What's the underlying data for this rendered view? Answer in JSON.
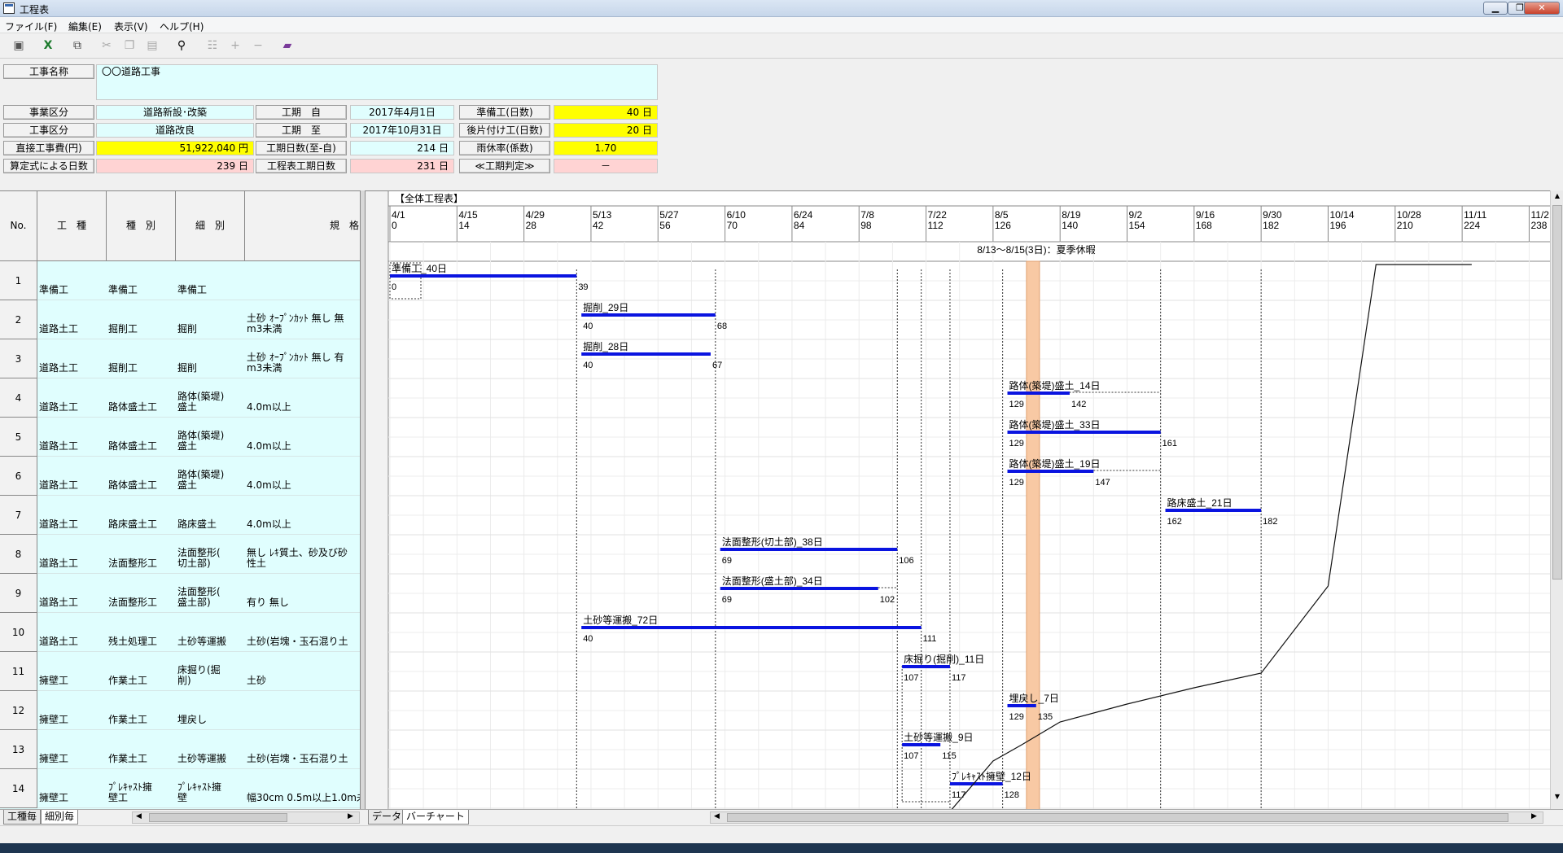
{
  "window": {
    "title": "工程表"
  },
  "menu": [
    "ファイル(F)",
    "編集(E)",
    "表示(V)",
    "ヘルプ(H)"
  ],
  "form": {
    "koji_name": {
      "label": "工事名称",
      "value": "〇〇道路工事"
    },
    "jigyo": {
      "label": "事業区分",
      "value": "道路新設･改築"
    },
    "koji_kubun": {
      "label": "工事区分",
      "value": "道路改良"
    },
    "chokusetsu": {
      "label": "直接工事費(円)",
      "value": "51,922,040 円"
    },
    "santei": {
      "label": "算定式による日数",
      "value": "239 日"
    },
    "kouki_from": {
      "label": "工期　自",
      "value": "2017年4月1日"
    },
    "kouki_to": {
      "label": "工期　至",
      "value": "2017年10月31日"
    },
    "kouki_days": {
      "label": "工期日数(至-自)",
      "value": "214 日"
    },
    "koteihyo_days": {
      "label": "工程表工期日数",
      "value": "231 日"
    },
    "junbi": {
      "label": "準備工(日数)",
      "value": "40 日"
    },
    "atokata": {
      "label": "後片付け工(日数)",
      "value": "20 日"
    },
    "ukyu": {
      "label": "雨休率(係数)",
      "value": "1.70"
    },
    "hantei": {
      "label": "≪工期判定≫",
      "value": "－"
    }
  },
  "grid": {
    "headers": {
      "no": "No.",
      "koshu": "工　種",
      "shubetsu": "種　別",
      "saibetsu": "細　別",
      "kikaku": "規　格"
    },
    "rows": [
      {
        "no": "1",
        "koshu": "準備工",
        "shubetsu": "準備工",
        "saibetsu": "準備工",
        "kikaku": ""
      },
      {
        "no": "2",
        "koshu": "道路土工",
        "shubetsu": "掘削工",
        "saibetsu": "掘削",
        "kikaku": "土砂 ｵｰﾌﾟﾝｶｯﾄ 無し 無\nm3未満"
      },
      {
        "no": "3",
        "koshu": "道路土工",
        "shubetsu": "掘削工",
        "saibetsu": "掘削",
        "kikaku": "土砂 ｵｰﾌﾟﾝｶｯﾄ 無し 有\nm3未満"
      },
      {
        "no": "4",
        "koshu": "道路土工",
        "shubetsu": "路体盛土工",
        "saibetsu": "路体(築堤)\n盛土",
        "kikaku": "4.0m以上"
      },
      {
        "no": "5",
        "koshu": "道路土工",
        "shubetsu": "路体盛土工",
        "saibetsu": "路体(築堤)\n盛土",
        "kikaku": "4.0m以上"
      },
      {
        "no": "6",
        "koshu": "道路土工",
        "shubetsu": "路体盛土工",
        "saibetsu": "路体(築堤)\n盛土",
        "kikaku": "4.0m以上"
      },
      {
        "no": "7",
        "koshu": "道路土工",
        "shubetsu": "路床盛土工",
        "saibetsu": "路床盛土",
        "kikaku": "4.0m以上"
      },
      {
        "no": "8",
        "koshu": "道路土工",
        "shubetsu": "法面整形工",
        "saibetsu": "法面整形(\n切土部)",
        "kikaku": "無し ﾚｷ質土、砂及び砂\n性土"
      },
      {
        "no": "9",
        "koshu": "道路土工",
        "shubetsu": "法面整形工",
        "saibetsu": "法面整形(\n盛土部)",
        "kikaku": "有り 無し"
      },
      {
        "no": "10",
        "koshu": "道路土工",
        "shubetsu": "残土処理工",
        "saibetsu": "土砂等運搬",
        "kikaku": "土砂(岩塊・玉石混り土"
      },
      {
        "no": "11",
        "koshu": "擁壁工",
        "shubetsu": "作業土工",
        "saibetsu": "床掘り(掘\n削)",
        "kikaku": "土砂"
      },
      {
        "no": "12",
        "koshu": "擁壁工",
        "shubetsu": "作業土工",
        "saibetsu": "埋戻し",
        "kikaku": ""
      },
      {
        "no": "13",
        "koshu": "擁壁工",
        "shubetsu": "作業土工",
        "saibetsu": "土砂等運搬",
        "kikaku": "土砂(岩塊・玉石混り土"
      },
      {
        "no": "14",
        "koshu": "擁壁工",
        "shubetsu": "ﾌﾟﾚｷｬｽﾄ擁\n壁工",
        "saibetsu": "ﾌﾟﾚｷｬｽﾄ擁\n壁",
        "kikaku": "幅30cm 0.5m以上1.0m未"
      }
    ]
  },
  "chart": {
    "title": "【全体工程表】",
    "holiday": "8/13～8/15(3日)：夏季休暇",
    "holiday_day": 134,
    "ticks": [
      {
        "date": "4/1",
        "day": "0"
      },
      {
        "date": "4/15",
        "day": "14"
      },
      {
        "date": "4/29",
        "day": "28"
      },
      {
        "date": "5/13",
        "day": "42"
      },
      {
        "date": "5/27",
        "day": "56"
      },
      {
        "date": "6/10",
        "day": "70"
      },
      {
        "date": "6/24",
        "day": "84"
      },
      {
        "date": "7/8",
        "day": "98"
      },
      {
        "date": "7/22",
        "day": "112"
      },
      {
        "date": "8/5",
        "day": "126"
      },
      {
        "date": "8/19",
        "day": "140"
      },
      {
        "date": "9/2",
        "day": "154"
      },
      {
        "date": "9/16",
        "day": "168"
      },
      {
        "date": "9/30",
        "day": "182"
      },
      {
        "date": "10/14",
        "day": "196"
      },
      {
        "date": "10/28",
        "day": "210"
      },
      {
        "date": "11/11",
        "day": "224"
      },
      {
        "date": "11/2",
        "day": "238"
      }
    ],
    "bars": [
      {
        "label": "準備工_40日",
        "start": 0,
        "end": 39,
        "start_label": "0",
        "end_label": "39"
      },
      {
        "label": "掘削_29日",
        "start": 40,
        "end": 68,
        "start_label": "40",
        "end_label": "68"
      },
      {
        "label": "掘削_28日",
        "start": 40,
        "end": 67,
        "start_label": "40",
        "end_label": "67"
      },
      {
        "label": "路体(築堤)盛土_14日",
        "start": 129,
        "end": 142,
        "start_label": "129",
        "end_label": "142"
      },
      {
        "label": "路体(築堤)盛土_33日",
        "start": 129,
        "end": 161,
        "start_label": "129",
        "end_label": "161"
      },
      {
        "label": "路体(築堤)盛土_19日",
        "start": 129,
        "end": 147,
        "start_label": "129",
        "end_label": "147"
      },
      {
        "label": "路床盛土_21日",
        "start": 162,
        "end": 182,
        "start_label": "162",
        "end_label": "182"
      },
      {
        "label": "法面整形(切土部)_38日",
        "start": 69,
        "end": 106,
        "start_label": "69",
        "end_label": "106"
      },
      {
        "label": "法面整形(盛土部)_34日",
        "start": 69,
        "end": 102,
        "start_label": "69",
        "end_label": "102"
      },
      {
        "label": "土砂等運搬_72日",
        "start": 40,
        "end": 111,
        "start_label": "40",
        "end_label": "111"
      },
      {
        "label": "床掘り(掘削)_11日",
        "start": 107,
        "end": 117,
        "start_label": "107",
        "end_label": "117"
      },
      {
        "label": "埋戻し_7日",
        "start": 129,
        "end": 135,
        "start_label": "129",
        "end_label": "135"
      },
      {
        "label": "土砂等運搬_9日",
        "start": 107,
        "end": 115,
        "start_label": "107",
        "end_label": "115"
      },
      {
        "label": "ﾌﾟﾚｷｬｽﾄ擁壁_12日",
        "start": 117,
        "end": 128,
        "start_label": "117",
        "end_label": "128"
      }
    ]
  },
  "sheets_left": [
    "工種毎",
    "細別毎"
  ],
  "sheets_right": [
    "データ",
    "バーチャート"
  ]
}
